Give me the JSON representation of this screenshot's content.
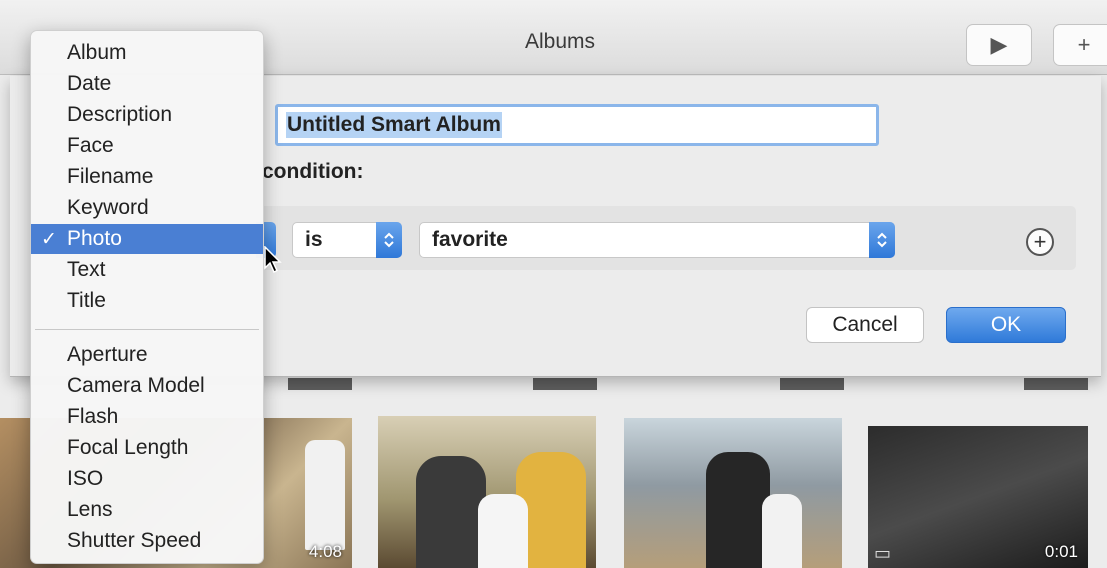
{
  "window": {
    "title": "Albums",
    "play_label": "▶",
    "add_label": "+"
  },
  "dialog": {
    "album_name": "Untitled Smart Album",
    "condition_label": "condition:",
    "rule": {
      "operator": "is",
      "value": "favorite",
      "stepper_glyph": "⌃⌄",
      "add_glyph": "+"
    },
    "cancel_label": "Cancel",
    "ok_label": "OK"
  },
  "menu": {
    "selected_check": "✓",
    "group1": [
      "Album",
      "Date",
      "Description",
      "Face",
      "Filename",
      "Keyword",
      "Photo",
      "Text",
      "Title"
    ],
    "group2": [
      "Aperture",
      "Camera Model",
      "Flash",
      "Focal Length",
      "ISO",
      "Lens",
      "Shutter Speed"
    ],
    "selected": "Photo"
  },
  "photos": [
    {
      "duration": "4:08"
    },
    {
      "duration": ""
    },
    {
      "duration": ""
    },
    {
      "duration": "0:01"
    }
  ]
}
